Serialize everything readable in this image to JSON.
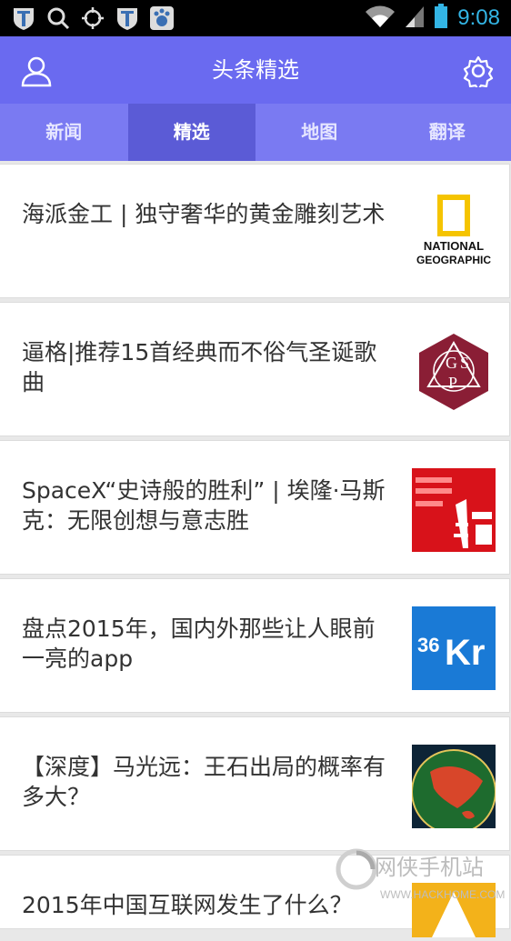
{
  "status_bar": {
    "time": "9:08"
  },
  "app_bar": {
    "title": "头条精选"
  },
  "tabs": [
    {
      "label": "新闻"
    },
    {
      "label": "精选",
      "active": true
    },
    {
      "label": "地图"
    },
    {
      "label": "翻译"
    }
  ],
  "articles": [
    {
      "title": "海派金工 | 独守奢华的黄金雕刻艺术",
      "thumb": "national-geographic-logo"
    },
    {
      "title": "逼格|推荐15首经典而不俗气圣诞歌曲",
      "thumb": "gsp-logo"
    },
    {
      "title": "SpaceX“史诗般的胜利” | 埃隆·马斯克：无限创想与意志胜",
      "thumb": "sanlian-shenghuo-logo"
    },
    {
      "title": "盘点2015年，国内外那些让人眼前一亮的app",
      "thumb": "36kr-logo"
    },
    {
      "title": "【深度】马光远：王石出局的概率有多大？",
      "thumb": "globe-map-image"
    },
    {
      "title": "2015年中国互联网发生了什么？",
      "thumb": "yellow-logo"
    }
  ],
  "watermark": {
    "name": "网侠手机站",
    "url": "WWW.HACKHOME.COM"
  },
  "colors": {
    "primary": "#6a6af0",
    "tab_bg": "#7a7af2",
    "tab_active": "#5b5bd6",
    "clock": "#33b5e5"
  }
}
